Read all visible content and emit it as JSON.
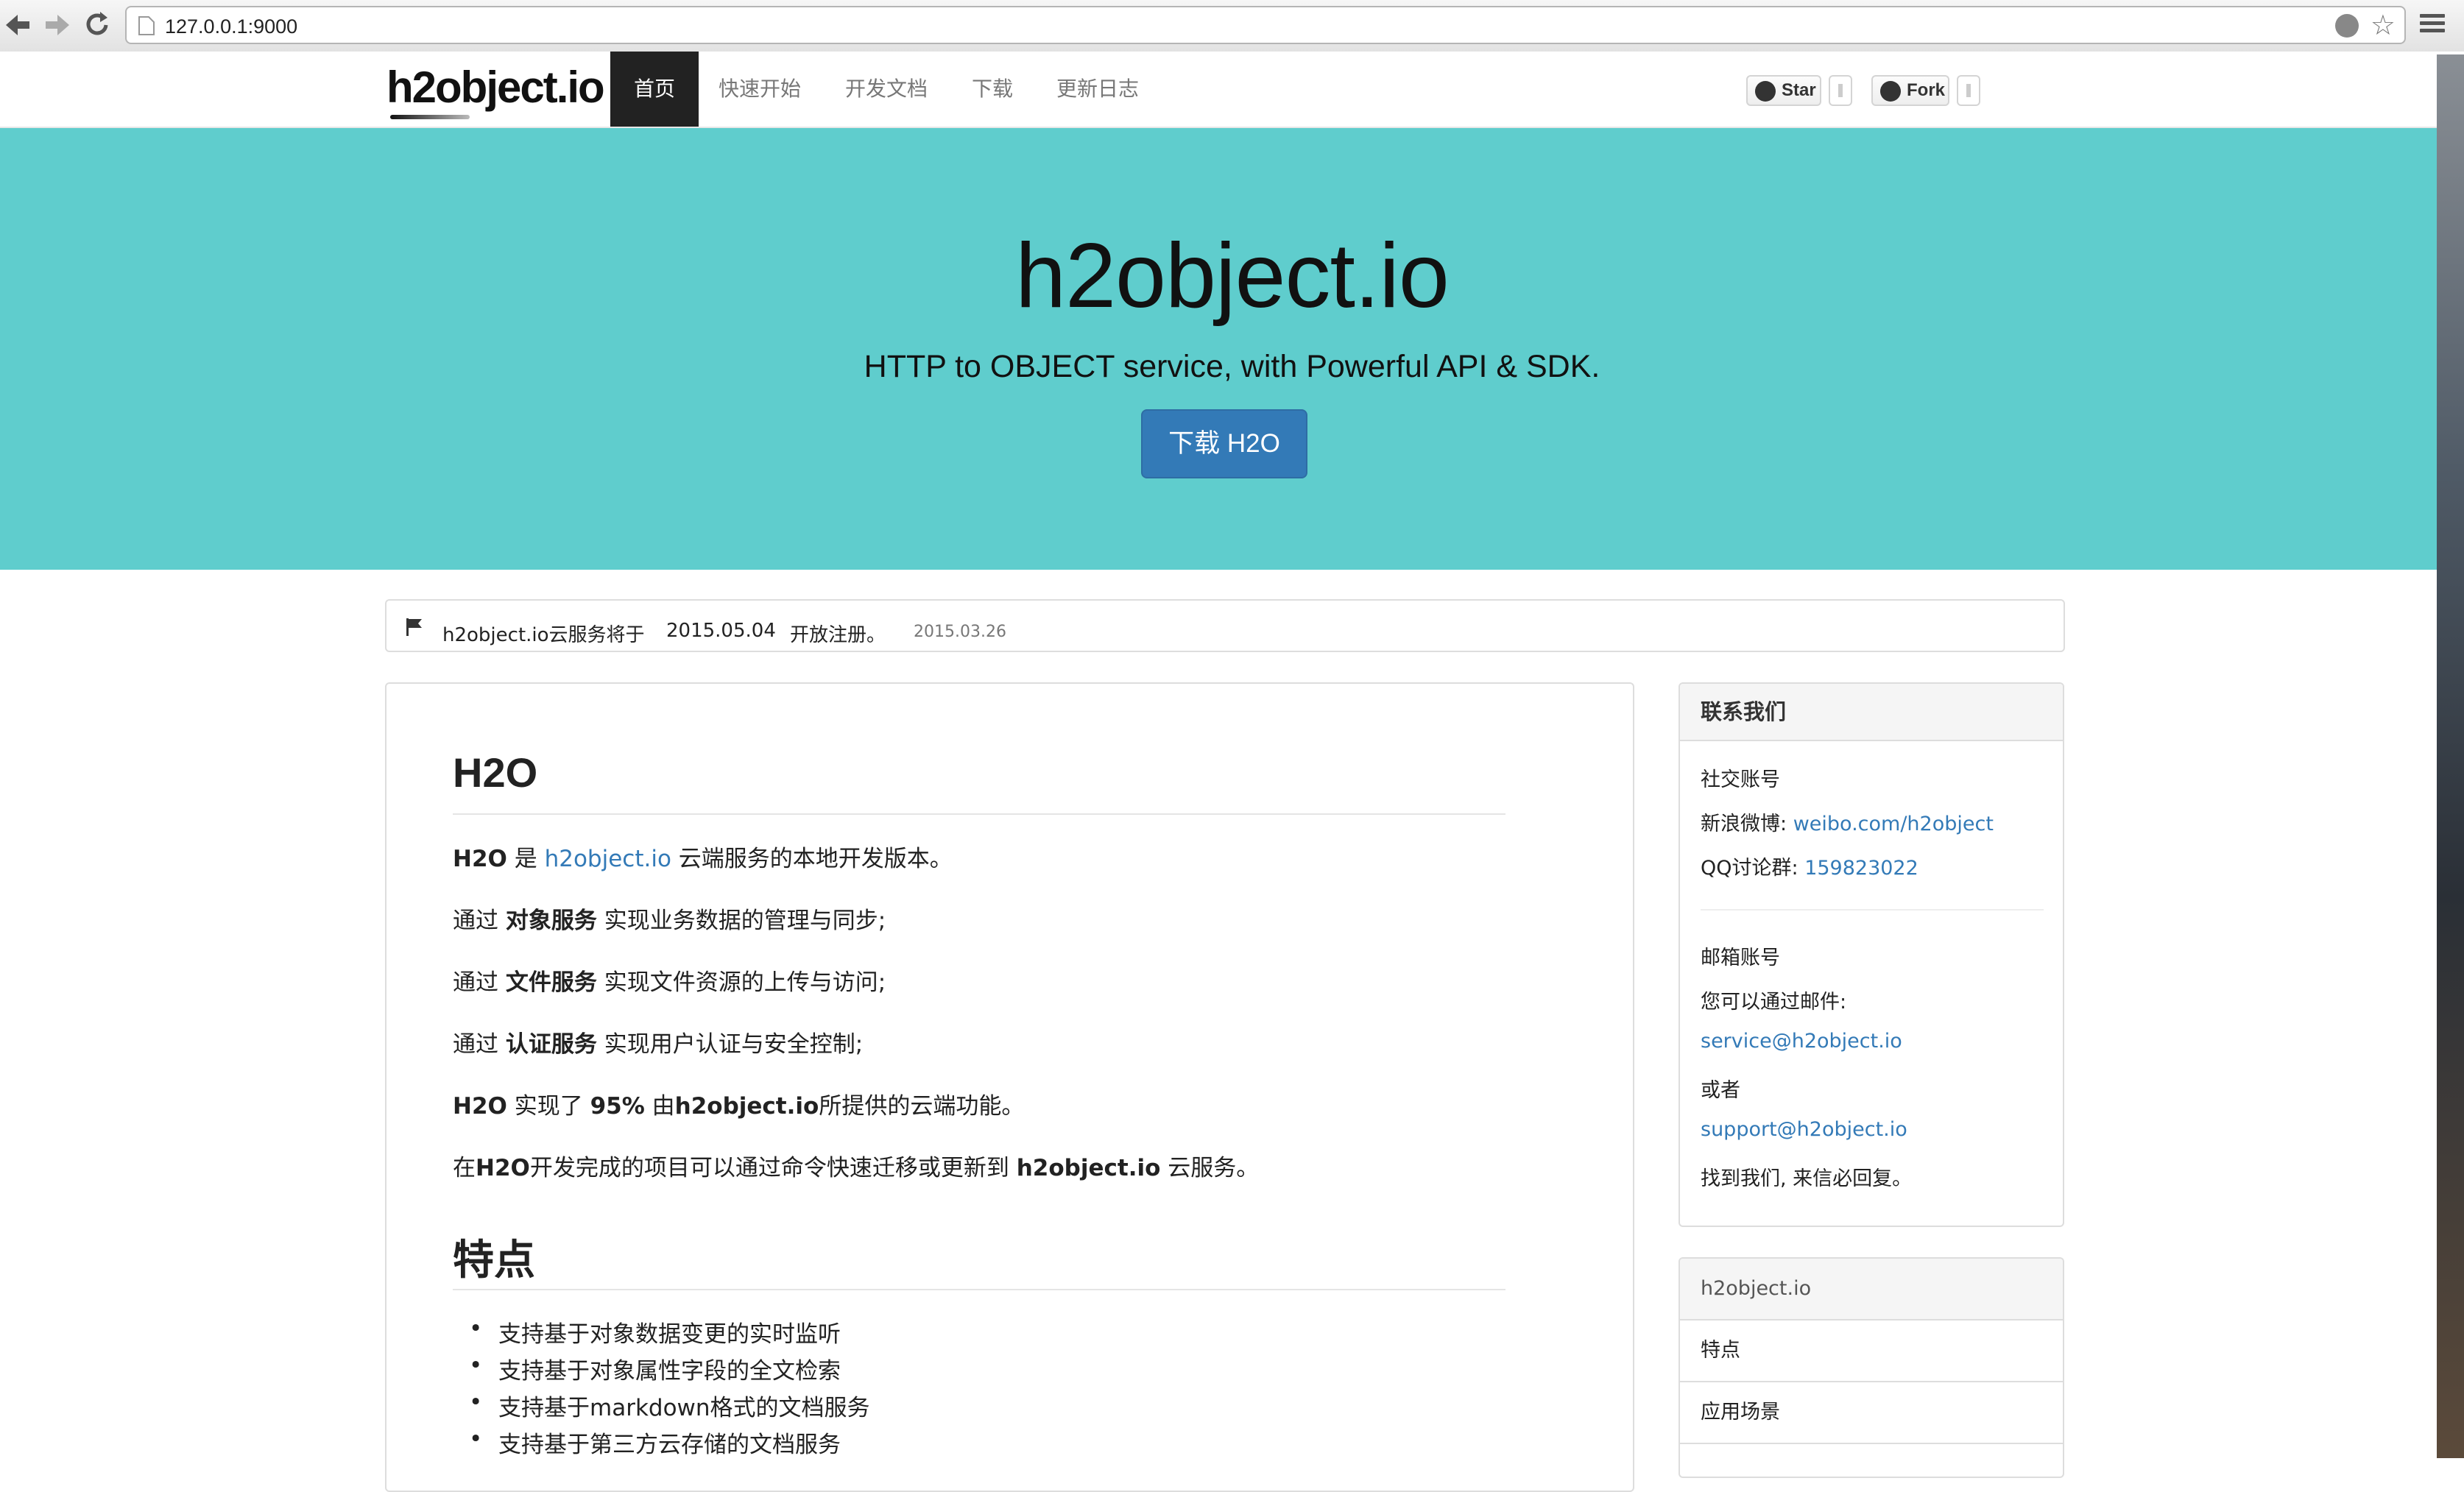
{
  "browser": {
    "url": "127.0.0.1:9000"
  },
  "navbar": {
    "brand": "h2object.io",
    "links": [
      {
        "label": "首页",
        "active": true
      },
      {
        "label": "快速开始",
        "active": false
      },
      {
        "label": "开发文档",
        "active": false
      },
      {
        "label": "下载",
        "active": false
      },
      {
        "label": "更新日志",
        "active": false
      }
    ],
    "github": {
      "star_label": "Star",
      "fork_label": "Fork"
    }
  },
  "hero": {
    "title": "h2object.io",
    "subtitle": "HTTP to OBJECT service, with Powerful API & SDK.",
    "button": "下载 H2O",
    "background": "#5fcdcd"
  },
  "notice": {
    "text1": "h2object.io云服务将于",
    "date": "2015.05.04",
    "text2": "开放注册。",
    "posted": "2015.03.26"
  },
  "content": {
    "h2o_title": "H2O",
    "intro": {
      "bold": "H2O",
      "mid": " 是 ",
      "link": "h2object.io",
      "rest": " 云端服务的本地开发版本。"
    },
    "lines": [
      {
        "pre": "通过 ",
        "bold": "对象服务",
        "post": " 实现业务数据的管理与同步;"
      },
      {
        "pre": "通过 ",
        "bold": "文件服务",
        "post": " 实现文件资源的上传与访问;"
      },
      {
        "pre": "通过 ",
        "bold": "认证服务",
        "post": " 实现用户认证与安全控制;"
      }
    ],
    "impl": {
      "bold1": "H2O",
      "t1": " 实现了 ",
      "bold2": "95%",
      "t2": " 由",
      "bold3": "h2object.io",
      "t3": "所提供的云端功能。"
    },
    "migrate": {
      "t1": "在",
      "bold1": "H2O",
      "t2": "开发完成的项目可以通过命令快速迁移或更新到 ",
      "bold2": "h2object.io",
      "t3": " 云服务。"
    },
    "features_title": "特点",
    "features": [
      "支持基于对象数据变更的实时监听",
      "支持基于对象属性字段的全文检索",
      "支持基于markdown格式的文档服务",
      "支持基于第三方云存储的文档服务"
    ]
  },
  "sidebar": {
    "contact": {
      "title": "联系我们",
      "social_label": "社交账号",
      "weibo_label": "新浪微博: ",
      "weibo_link": "weibo.com/h2object",
      "qq_label": "QQ讨论群: ",
      "qq_link": "159823022",
      "email_label": "邮箱账号",
      "email_intro": "您可以通过邮件:",
      "email1": "service@h2object.io",
      "or": "或者",
      "email2": "support@h2object.io",
      "reply": "找到我们, 来信必回复。"
    },
    "nav": {
      "title": "h2object.io",
      "items": [
        "特点",
        "应用场景"
      ]
    }
  }
}
